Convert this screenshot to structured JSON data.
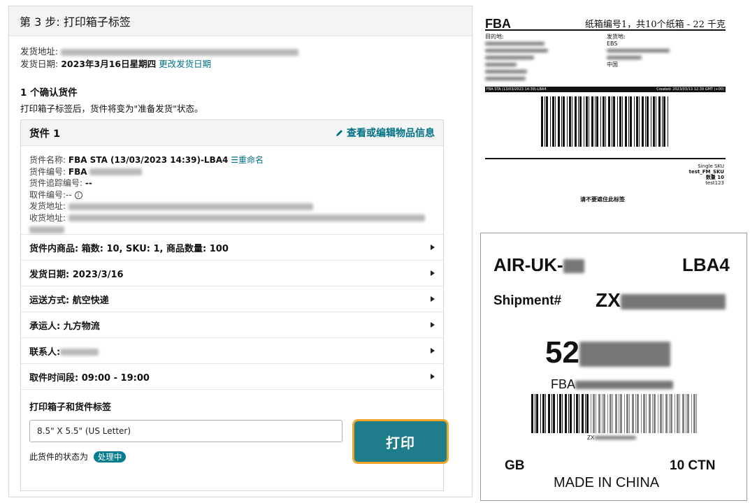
{
  "step": {
    "title": "第 3 步:  打印箱子标签"
  },
  "ship_from": {
    "label": "发货地址:"
  },
  "ship_date": {
    "label": "发货日期:",
    "value": "2023年3月16日星期四",
    "change_link": "更改发货日期"
  },
  "confirmed": {
    "title": "1 个确认货件",
    "note": "打印箱子标签后，货件将变为\"准备发货\"状态。"
  },
  "shipment": {
    "title": "货件 1",
    "edit_link": "查看或编辑物品信息",
    "name_label": "货件名称:",
    "name_value": "FBA STA (13/03/2023 14:39)-LBA4",
    "rename_link": "重命名",
    "id_label": "货件编号:",
    "id_value": "FBA",
    "tracking_label": "货件追踪编号:",
    "tracking_value": "--",
    "pickup_label": "取件编号:",
    "pickup_value": "--",
    "from_label": "发货地址:",
    "to_label": "收货地址:"
  },
  "rows": [
    {
      "label": "货件内商品: 箱数:  10, SKU:  1, 商品数量:  100"
    },
    {
      "label": "发货日期: 2023/3/16"
    },
    {
      "label": "运送方式: 航空快递"
    },
    {
      "label": "承运人: 九方物流"
    },
    {
      "label": "联系人:"
    },
    {
      "label": "取件时间段: 09:00 - 19:00"
    }
  ],
  "print": {
    "title": "打印箱子和货件标签",
    "selected_size": "8.5\" X 5.5\" (US Letter)",
    "button": "打印",
    "status_prefix": "此货件的状态为",
    "status_badge": "处理中"
  },
  "label1": {
    "fba": "FBA",
    "header": "纸箱编号1，共10个纸箱 - 22 千克",
    "dest_label": "目的地:",
    "from_label": "发货地:",
    "from_line1": "EBS",
    "country_from": "中国",
    "strip_left": "FBA STA (13/03/2023 14:39)-LBA4",
    "strip_right": "Created: 2023/03/13 12:39 GMT (+00)",
    "single_sku": "Single SKU",
    "sku_line2": "test_FM_SKU",
    "qty": "数量 10",
    "sku_line4": "test123",
    "notice": "请不要遮住此标签"
  },
  "label2": {
    "route": "AIR-UK-",
    "dest": "LBA4",
    "shipment_label": "Shipment#",
    "shipment_prefix": "ZX",
    "big_number": "52",
    "fba_prefix": "FBA",
    "zx_small": "ZX",
    "country": "GB",
    "ctn": "10 CTN",
    "made_in": "MADE IN CHINA"
  },
  "icons": {
    "edit": "pencil-icon",
    "info": "info-circle-icon",
    "row": "triangle-right-icon"
  }
}
